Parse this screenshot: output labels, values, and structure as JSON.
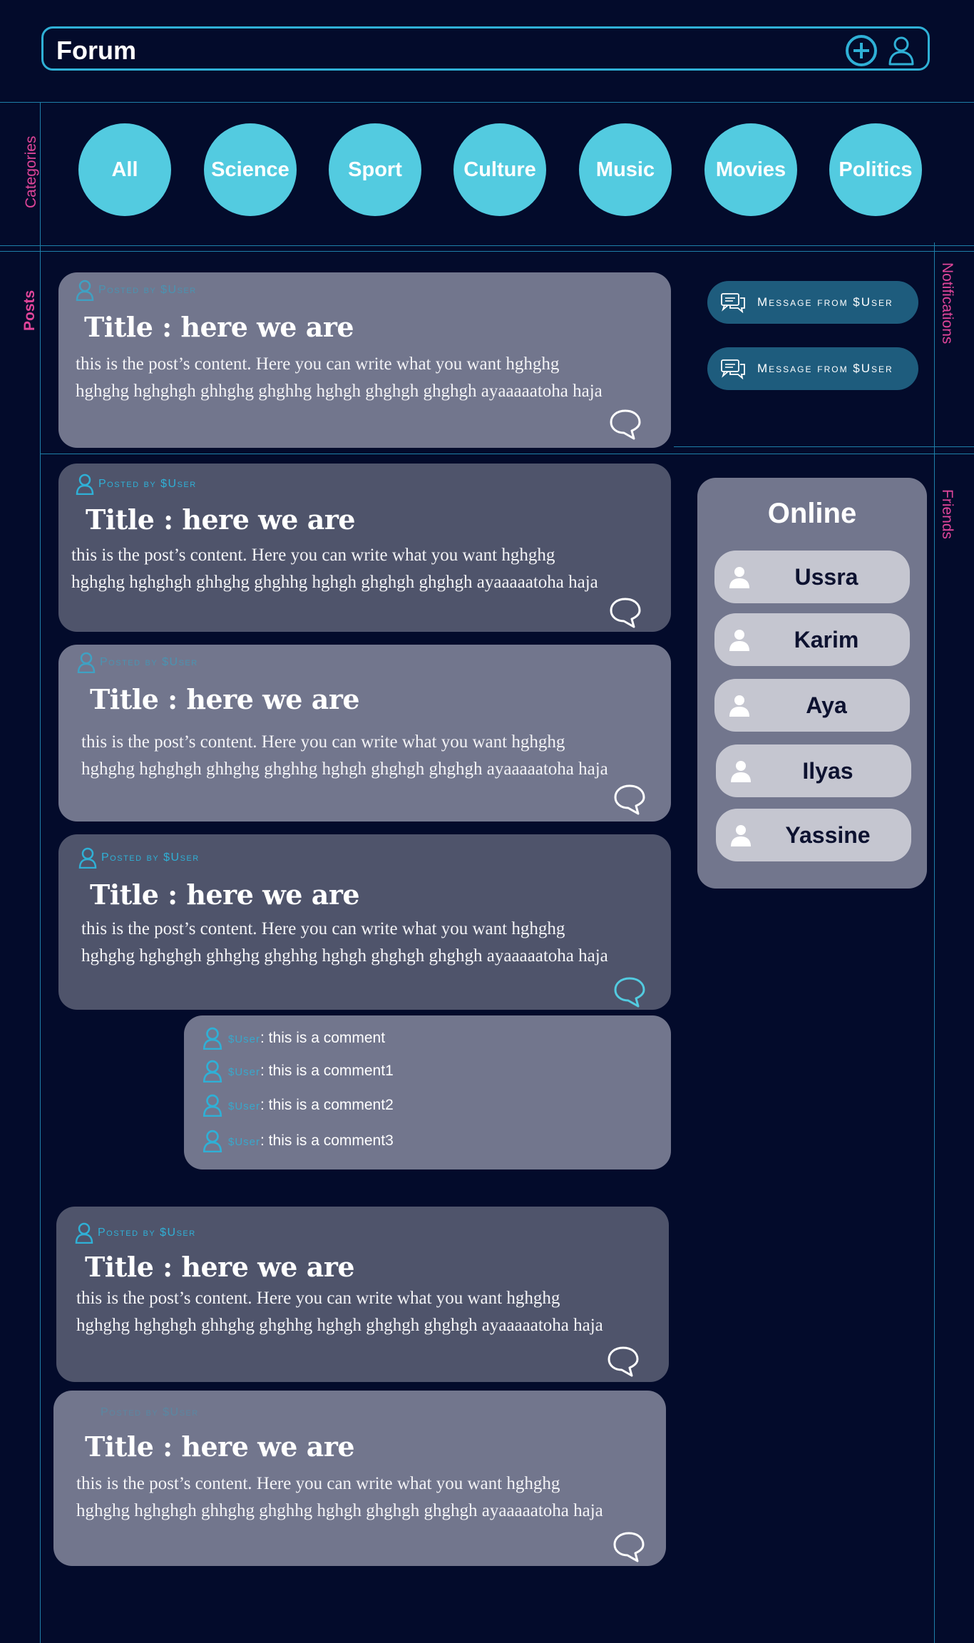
{
  "header": {
    "title": "Forum"
  },
  "sidebar_labels": {
    "categories": "Categories",
    "posts": "Posts",
    "notifications": "Notifications",
    "friends": "Friends"
  },
  "categories": [
    "All",
    "Science",
    "Sport",
    "Culture",
    "Music",
    "Movies",
    "Politics"
  ],
  "posts": [
    {
      "meta": "Posted by $User",
      "title": "Title : here we are",
      "line1": "this is the post’s content. Here you can write what you want hghghg",
      "line2": "hghghg hghghgh ghhghg ghghhg hghgh ghghgh ghghgh ayaaaaatoha haja"
    },
    {
      "meta": "Posted by $User",
      "title": "Title : here we are",
      "line1": "this is the post’s content. Here you can write what you want hghghg",
      "line2": "hghghg hghghgh ghhghg ghghhg hghgh ghghgh ghghgh ayaaaaatoha haja"
    },
    {
      "meta": "Posted by $User",
      "title": "Title : here we are",
      "line1": "this is the post’s content. Here you can write what you want hghghg",
      "line2": "hghghg hghghgh ghhghg ghghhg hghgh ghghgh ghghgh ayaaaaatoha haja"
    },
    {
      "meta": "Posted by $User",
      "title": "Title : here we are",
      "line1": "this is the post’s content. Here you can write what you want hghghg",
      "line2": "hghghg hghghgh ghhghg ghghhg hghgh ghghgh ghghgh ayaaaaatoha haja"
    },
    {
      "meta": "Posted by $User",
      "title": "Title : here we are",
      "line1": "this is the post’s content. Here you can write what you want hghghg",
      "line2": "hghghg hghghgh ghhghg ghghhg hghgh ghghgh ghghgh ayaaaaatoha haja"
    },
    {
      "meta": "Posted by $User",
      "title": "Title : here we are",
      "line1": "this is the post’s content. Here you can write what you want hghghg",
      "line2": "hghghg hghghgh ghhghg ghghhg hghgh ghghgh ghghgh ayaaaaatoha haja"
    }
  ],
  "comments": [
    {
      "user": "$User",
      "text": ": this is a comment"
    },
    {
      "user": "$User",
      "text": ": this is a comment1"
    },
    {
      "user": "$User",
      "text": ": this is a comment2"
    },
    {
      "user": "$User",
      "text": ": this is a comment3"
    }
  ],
  "notifications": [
    "Message from $User",
    "Message from $User"
  ],
  "online": {
    "title": "Online",
    "friends": [
      "Ussra",
      "Karim",
      "Aya",
      "Ilyas",
      "Yassine"
    ]
  },
  "colors": {
    "background": "#030b2b",
    "accent": "#2fb0d6",
    "category": "#53cbe0",
    "label": "#e0459a",
    "post_light": "#72768d",
    "post_dark": "#4f546b",
    "notification": "#1e5c7d"
  }
}
